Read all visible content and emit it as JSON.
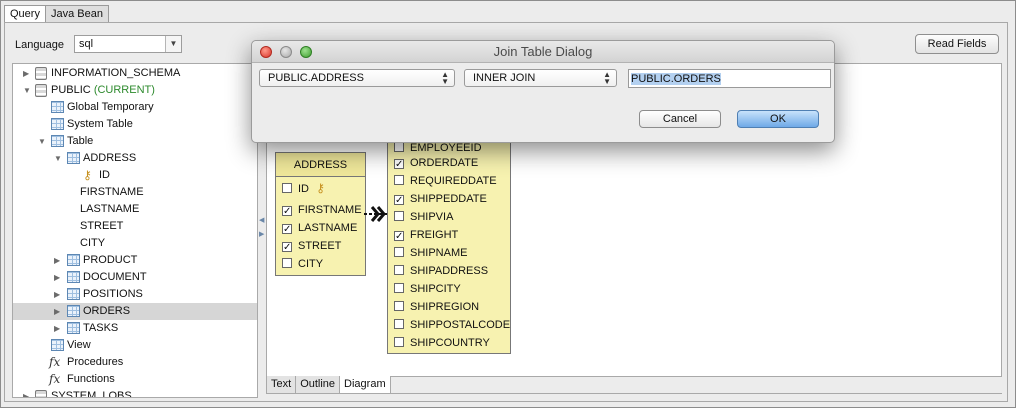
{
  "tabs": [
    {
      "label": "Query"
    },
    {
      "label": "Java Bean"
    }
  ],
  "language": {
    "label": "Language",
    "value": "sql"
  },
  "read_fields_label": "Read Fields",
  "tree": {
    "schema_info": "INFORMATION_SCHEMA",
    "schema_public": "PUBLIC",
    "schema_public_tag": "(CURRENT)",
    "global_temporary": "Global Temporary",
    "system_table": "System Table",
    "table": "Table",
    "address": "ADDRESS",
    "address_columns": [
      "ID",
      "FIRSTNAME",
      "LASTNAME",
      "STREET",
      "CITY"
    ],
    "product": "PRODUCT",
    "document": "DOCUMENT",
    "positions": "POSITIONS",
    "orders": "ORDERS",
    "tasks": "TASKS",
    "view": "View",
    "procedures": "Procedures",
    "functions": "Functions",
    "fx_symbol": "fx",
    "system_lobs": "SYSTEM_LOBS"
  },
  "diagram": {
    "address_title": "ADDRESS",
    "address_fields": [
      {
        "name": "ID",
        "checked": false,
        "key": true
      },
      {
        "name": "FIRSTNAME",
        "checked": true
      },
      {
        "name": "LASTNAME",
        "checked": true
      },
      {
        "name": "STREET",
        "checked": true
      },
      {
        "name": "CITY",
        "checked": false
      }
    ],
    "orders_fields": [
      {
        "name": "EMPLOYEEID",
        "checked": false
      },
      {
        "name": "ORDERDATE",
        "checked": true
      },
      {
        "name": "REQUIREDDATE",
        "checked": false
      },
      {
        "name": "SHIPPEDDATE",
        "checked": true
      },
      {
        "name": "SHIPVIA",
        "checked": false
      },
      {
        "name": "FREIGHT",
        "checked": true
      },
      {
        "name": "SHIPNAME",
        "checked": false
      },
      {
        "name": "SHIPADDRESS",
        "checked": false
      },
      {
        "name": "SHIPCITY",
        "checked": false
      },
      {
        "name": "SHIPREGION",
        "checked": false
      },
      {
        "name": "SHIPPOSTALCODE",
        "checked": false
      },
      {
        "name": "SHIPCOUNTRY",
        "checked": false
      }
    ]
  },
  "bottom_tabs": [
    {
      "label": "Text"
    },
    {
      "label": "Outline"
    },
    {
      "label": "Diagram"
    }
  ],
  "dialog": {
    "title": "Join Table Dialog",
    "left_table": "PUBLIC.ADDRESS",
    "join_type": "INNER JOIN",
    "right_table": "PUBLIC.ORDERS",
    "cancel_label": "Cancel",
    "ok_label": "OK"
  },
  "colors": {
    "accent": "#6fa9e7",
    "entity_fill": "#f7f2b0",
    "current_schema": "#2d8a2d"
  },
  "icons": [
    "database-icon",
    "table-icon",
    "key-icon",
    "fx-icon",
    "chevron-down-icon",
    "triangle-right-icon",
    "triangle-down-icon"
  ]
}
